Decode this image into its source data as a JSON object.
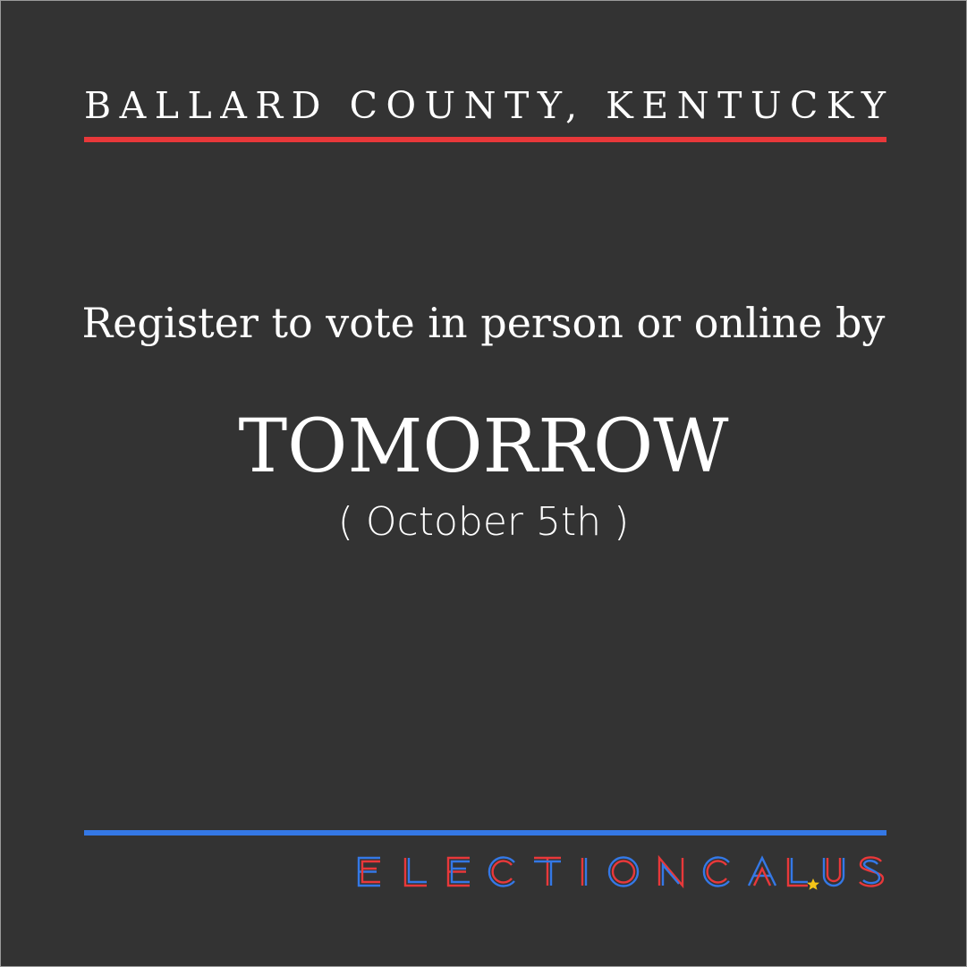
{
  "header": {
    "county": "BALLARD COUNTY, KENTUCKY"
  },
  "main": {
    "register_text": "Register to vote in person or online by",
    "deadline": "TOMORROW",
    "date": "( October 5th )"
  },
  "footer": {
    "logo_text": "ELECTIONCAL.US"
  },
  "colors": {
    "background": "#333333",
    "accent_red": "#e8383a",
    "accent_blue": "#3478e6",
    "star": "#f5c518"
  },
  "icons": {
    "logo_dot": "star-icon"
  }
}
